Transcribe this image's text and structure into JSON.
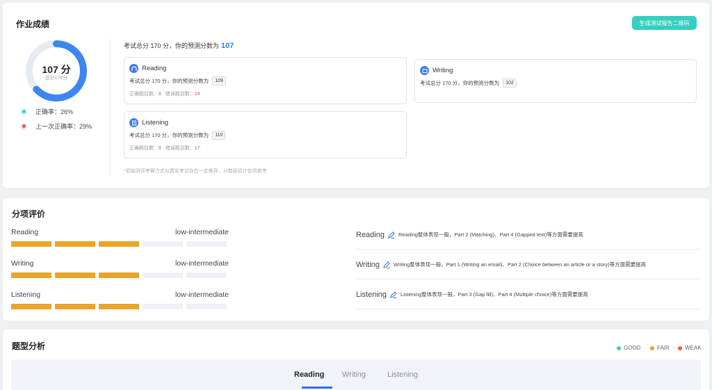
{
  "score_card": {
    "title": "作业成绩",
    "qr_button": "生成测试报告二维码",
    "score_display": "107 分",
    "score_sub": "总分170分",
    "score_fraction": 0.63,
    "correct_rate": "正确率：26%",
    "last_rate": "上一次正确率：29%",
    "total_text": "考试总分 170 分，你的预测分数为",
    "total_predict": "107",
    "note": "*初始测评考察方式与真实考试存在一定差异，分数段估计仅供参考",
    "colors": {
      "ring": "#3d86f0",
      "ring_track": "#e6ebf3",
      "correct_dot": "#34cfc0",
      "last_dot": "#e85a4f"
    }
  },
  "sections": [
    {
      "name": "Reading",
      "predict_text": "考试总分 170 分，你的预测分数为",
      "predict": "109",
      "correct_label": "正确题目数：",
      "correct": "8",
      "wrong_label": "错误题目数：",
      "wrong": "24"
    },
    {
      "name": "Listening",
      "predict_text": "考试总分 170 分，你的预测分数为",
      "predict": "110",
      "correct_label": "正确题目数：",
      "correct": "8",
      "wrong_label": "错误题目数：",
      "wrong": "17"
    },
    {
      "name": "Writing",
      "predict_text": "考试总分 170 分，你的预测分数为",
      "predict": "102"
    }
  ],
  "evaluation": {
    "title": "分项评价",
    "skills": [
      {
        "name": "Reading",
        "level": "low-intermediate",
        "filled": 3,
        "total": 5
      },
      {
        "name": "Writing",
        "level": "low-intermediate",
        "filled": 3,
        "total": 5
      },
      {
        "name": "Listening",
        "level": "low-intermediate",
        "filled": 3,
        "total": 5
      }
    ],
    "comments": [
      {
        "name": "Reading",
        "text": "Reading整体表现一般，Part 2 (Matching)、Part 4 (Gapped text)等方面需要提高"
      },
      {
        "name": "Writing",
        "text": "Writing整体表现一般，Part 1 (Writing an email)、Part 2 (Choice between an article or a story)等方面需要提高"
      },
      {
        "name": "Listening",
        "text": "Listening整体表现一般，Part 3 (Gap fill)、Part 4 (Multiple choice)等方面需要提高"
      }
    ]
  },
  "analysis": {
    "title": "题型分析",
    "legend": [
      {
        "label": "GOOD",
        "color": "#34cfc0"
      },
      {
        "label": "FAIR",
        "color": "#eba42a"
      },
      {
        "label": "WEAK",
        "color": "#e85a4f"
      }
    ],
    "tabs": [
      "Reading",
      "Writing",
      "Listening"
    ],
    "active_tab": "Reading"
  }
}
